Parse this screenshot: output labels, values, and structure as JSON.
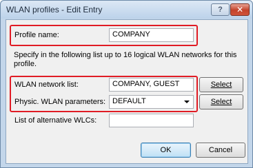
{
  "window": {
    "title": "WLAN profiles - Edit Entry",
    "help_label": "?",
    "close_label": "✕"
  },
  "form": {
    "profile_name_label": "Profile name:",
    "profile_name_value": "COMPANY",
    "description": "Specify in the following list up to 16 logical WLAN networks for this profile.",
    "wlan_list_label": "WLAN network list:",
    "wlan_list_value": "COMPANY, GUEST",
    "wlan_list_select": "Select",
    "phys_label": "Physic. WLAN parameters:",
    "phys_value": "DEFAULT",
    "phys_select": "Select",
    "alt_wlc_label": "List of alternative WLCs:",
    "alt_wlc_value": ""
  },
  "buttons": {
    "ok": "OK",
    "cancel": "Cancel"
  },
  "colors": {
    "highlight": "#e01b24"
  }
}
